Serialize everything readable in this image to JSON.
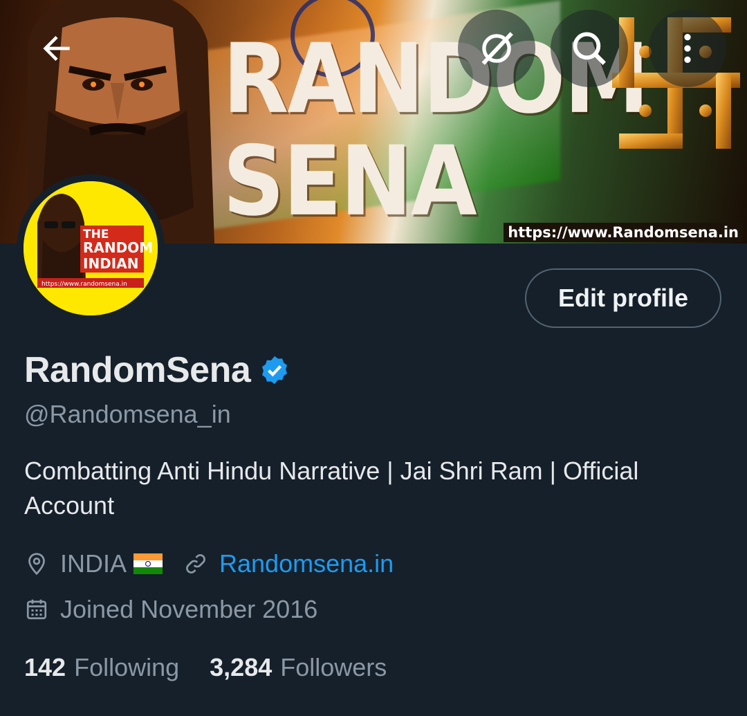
{
  "header": {
    "banner_title_line1": "RANDOM",
    "banner_title_line2": "SENA",
    "banner_url": "https://www.Randomsena.in",
    "back_icon": "arrow-left-icon",
    "grok_icon": "grok-icon",
    "search_icon": "search-icon",
    "more_icon": "more-vertical-icon"
  },
  "avatar": {
    "line1": "THE",
    "line2": "RANDOM",
    "line3": "INDIAN",
    "url": "https://www.randomsena.in"
  },
  "actions": {
    "edit_profile_label": "Edit profile"
  },
  "profile": {
    "display_name": "RandomSena",
    "verified": true,
    "handle": "@Randomsena_in",
    "bio": "Combatting Anti Hindu Narrative | Jai Shri Ram | Official Account",
    "location": "INDIA",
    "website": "Randomsena.in",
    "joined": "Joined November 2016"
  },
  "stats": {
    "following_count": "142",
    "following_label": "Following",
    "followers_count": "3,284",
    "followers_label": "Followers"
  },
  "colors": {
    "background": "#15202b",
    "accent": "#1d9bf0",
    "secondary_text": "#8b98a5",
    "avatar_bg": "#ffe800"
  }
}
